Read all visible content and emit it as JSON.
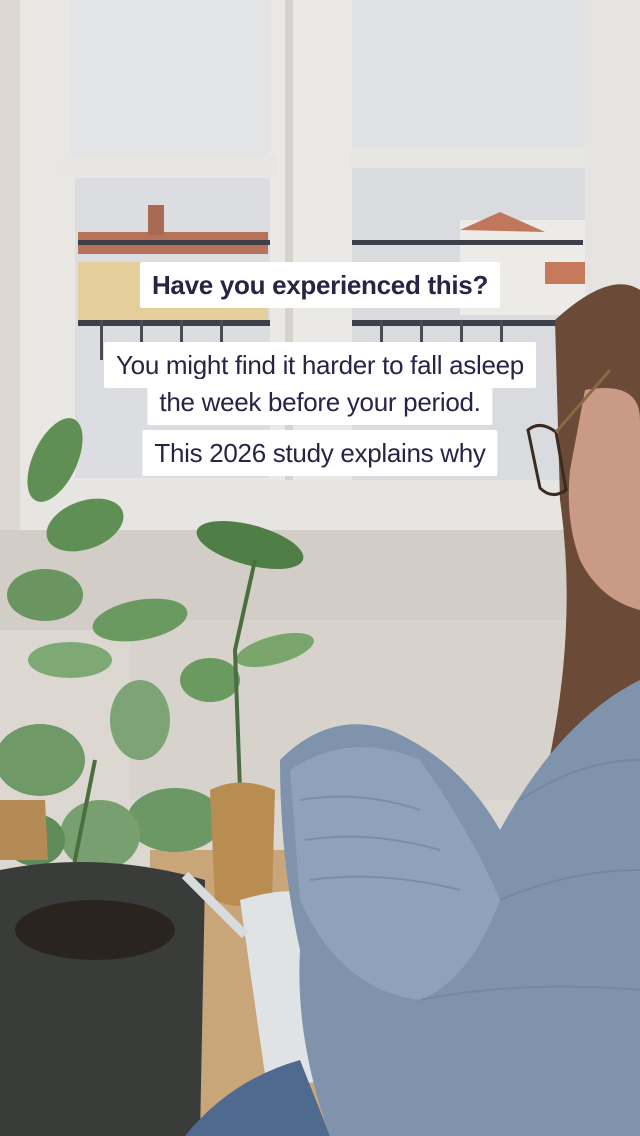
{
  "captions": {
    "title": "Have you experienced this?",
    "line1": "You might find it harder to fall asleep",
    "line2": "the week before your period.",
    "line3": "This 2026 study explains why"
  },
  "colors": {
    "caption_bg": "#ffffff",
    "caption_text": "#2b2245",
    "sweater": "#7f93ad",
    "leaf": "#5f8f55",
    "pot": "#3a3c3a",
    "window_frame": "#eceae6"
  }
}
